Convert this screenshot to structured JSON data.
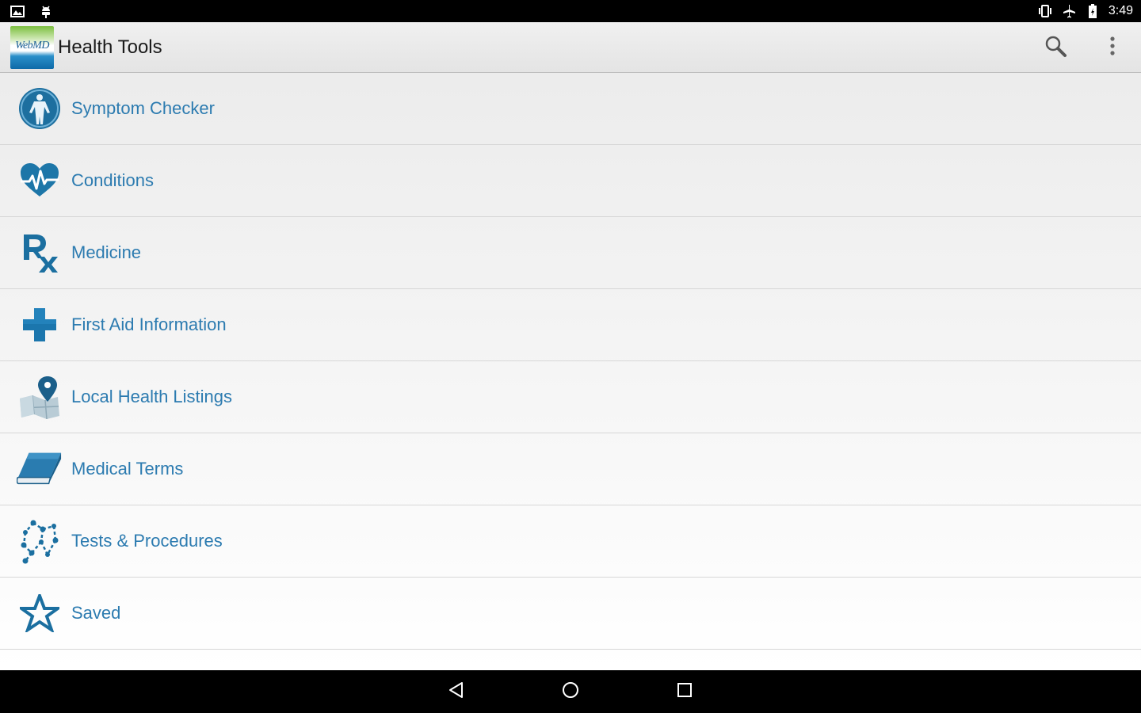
{
  "status_bar": {
    "time": "3:49",
    "left_icons": [
      "gallery-notification-icon",
      "android-debug-icon"
    ],
    "right_icons": [
      "vibrate-icon",
      "airplane-mode-icon",
      "battery-icon"
    ]
  },
  "app_bar": {
    "logo_text": "WebMD",
    "title": "Health Tools",
    "actions": [
      "search-icon",
      "overflow-menu-icon"
    ]
  },
  "list": {
    "items": [
      {
        "label": "Symptom Checker",
        "icon": "body-figure-icon"
      },
      {
        "label": "Conditions",
        "icon": "heart-pulse-icon"
      },
      {
        "label": "Medicine",
        "icon": "rx-icon"
      },
      {
        "label": "First Aid Information",
        "icon": "medical-cross-icon"
      },
      {
        "label": "Local Health Listings",
        "icon": "map-pin-icon"
      },
      {
        "label": "Medical Terms",
        "icon": "book-icon"
      },
      {
        "label": "Tests & Procedures",
        "icon": "molecule-icon"
      },
      {
        "label": "Saved",
        "icon": "star-icon"
      }
    ]
  },
  "nav_bar": {
    "buttons": [
      "back-icon",
      "home-icon",
      "recents-icon"
    ]
  },
  "colors": {
    "accent": "#2c7bb0",
    "icon_blue": "#1b6fa0",
    "status_bar": "#000000",
    "app_bar": "#e8e8e8"
  }
}
